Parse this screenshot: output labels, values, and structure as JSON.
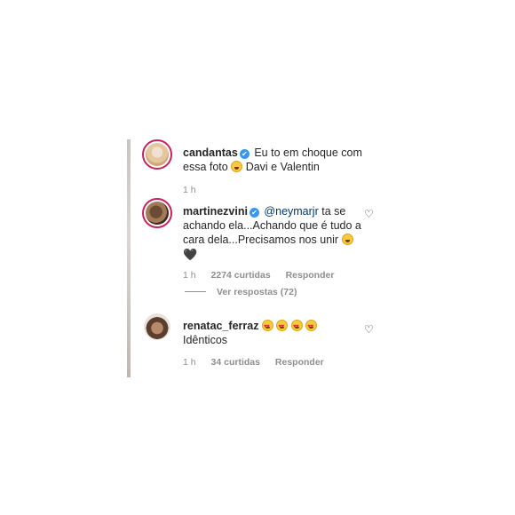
{
  "comments": [
    {
      "username": "candantas",
      "verified": true,
      "text_before": "Eu to em choque com essa foto",
      "emoji_1": "laughing-face",
      "text_after": "Davi e Valentin",
      "time": "1 h"
    },
    {
      "username": "martinezvini",
      "verified": true,
      "mention": "@neymarjr",
      "text": "ta se achando ela...Achando que é tudo a cara dela...Precisamos nos unir",
      "emoji_1": "laughing-face",
      "heart": "🖤",
      "time": "1 h",
      "likes": "2274 curtidas",
      "reply_label": "Responder",
      "view_replies": "Ver respostas (72)"
    },
    {
      "username": "renatac_ferraz",
      "verified": false,
      "emojis": [
        "heart-eyes",
        "heart-eyes",
        "heart-eyes",
        "heart-eyes"
      ],
      "text": "Idênticos",
      "time": "1 h",
      "likes": "34 curtidas",
      "reply_label": "Responder"
    }
  ],
  "icons": {
    "verified": "✔",
    "like": "♡"
  }
}
